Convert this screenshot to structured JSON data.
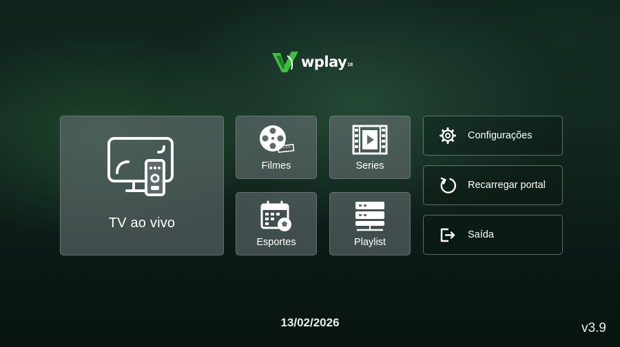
{
  "logo": {
    "text": "wplay",
    "superscript": "18"
  },
  "tiles": {
    "live_tv": {
      "label": "TV ao vivo",
      "icon": "tv-remote-icon"
    },
    "movies": {
      "label": "Filmes",
      "icon": "film-reel-icon"
    },
    "series": {
      "label": "Series",
      "icon": "film-strip-play-icon"
    },
    "sports": {
      "label": "Esportes",
      "icon": "calendar-soccer-icon"
    },
    "playlist": {
      "label": "Playlist",
      "icon": "server-stack-icon"
    }
  },
  "actions": {
    "settings": {
      "label": "Configurações",
      "icon": "gear-icon"
    },
    "reload": {
      "label": "Recarregar portal",
      "icon": "reload-icon"
    },
    "exit": {
      "label": "Saída",
      "icon": "exit-icon"
    }
  },
  "footer": {
    "date": "13/02/2026",
    "version": "v3.9"
  },
  "colors": {
    "background": "#10241c",
    "tile": "#5f6a6c",
    "logo_green": "#3fbf3f",
    "text": "#ffffff"
  }
}
